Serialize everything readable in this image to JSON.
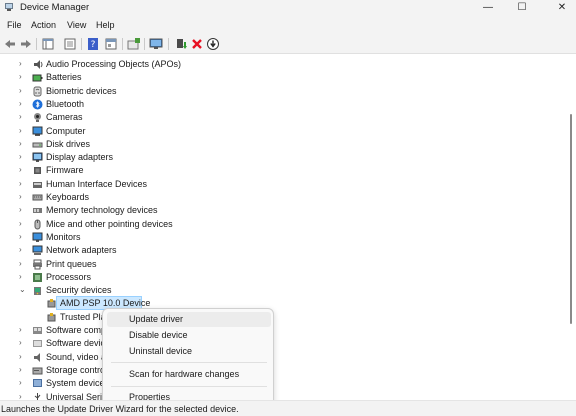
{
  "window": {
    "title": "Device Manager",
    "minimize": "—",
    "maximize": "☐",
    "close": "✕"
  },
  "menu": [
    "File",
    "Action",
    "View",
    "Help"
  ],
  "toolbar": [
    "back-icon",
    "forward-icon",
    "show-hide-tree-icon",
    "properties-icon",
    "help-icon",
    "view-resources-icon",
    "update-driver-icon",
    "scan-hardware-icon",
    "add-driver-icon",
    "uninstall-icon",
    "disable-icon"
  ],
  "tree": [
    {
      "label": "Audio Processing Objects (APOs)",
      "icon": "speaker-icon",
      "expanded": false
    },
    {
      "label": "Batteries",
      "icon": "battery-icon",
      "expanded": false
    },
    {
      "label": "Biometric devices",
      "icon": "fingerprint-icon",
      "expanded": false
    },
    {
      "label": "Bluetooth",
      "icon": "bluetooth-icon",
      "expanded": false
    },
    {
      "label": "Cameras",
      "icon": "camera-icon",
      "expanded": false
    },
    {
      "label": "Computer",
      "icon": "computer-icon",
      "expanded": false
    },
    {
      "label": "Disk drives",
      "icon": "disk-icon",
      "expanded": false
    },
    {
      "label": "Display adapters",
      "icon": "display-icon",
      "expanded": false
    },
    {
      "label": "Firmware",
      "icon": "chip-icon",
      "expanded": false
    },
    {
      "label": "Human Interface Devices",
      "icon": "hid-icon",
      "expanded": false
    },
    {
      "label": "Keyboards",
      "icon": "keyboard-icon",
      "expanded": false
    },
    {
      "label": "Memory technology devices",
      "icon": "memory-icon",
      "expanded": false
    },
    {
      "label": "Mice and other pointing devices",
      "icon": "mouse-icon",
      "expanded": false
    },
    {
      "label": "Monitors",
      "icon": "monitor-icon",
      "expanded": false
    },
    {
      "label": "Network adapters",
      "icon": "network-icon",
      "expanded": false
    },
    {
      "label": "Print queues",
      "icon": "printer-icon",
      "expanded": false
    },
    {
      "label": "Processors",
      "icon": "processor-icon",
      "expanded": false
    },
    {
      "label": "Security devices",
      "icon": "security-icon",
      "expanded": true
    },
    {
      "label": "AMD PSP 10.0 Device",
      "icon": "security-device-icon",
      "child": true,
      "selected": true
    },
    {
      "label": "Trusted Pla",
      "icon": "security-device-icon",
      "child": true
    },
    {
      "label": "Software comp",
      "icon": "software-component-icon",
      "expanded": false
    },
    {
      "label": "Software devic",
      "icon": "software-device-icon",
      "expanded": false
    },
    {
      "label": "Sound, video a",
      "icon": "sound-icon",
      "expanded": false
    },
    {
      "label": "Storage contro",
      "icon": "storage-icon",
      "expanded": false
    },
    {
      "label": "System device",
      "icon": "system-icon",
      "expanded": false
    },
    {
      "label": "Universal Seri",
      "icon": "usb-icon",
      "expanded": false
    }
  ],
  "context_menu": {
    "update": "Update driver",
    "disable": "Disable device",
    "uninstall": "Uninstall device",
    "scan": "Scan for hardware changes",
    "properties": "Properties"
  },
  "status": "Launches the Update Driver Wizard for the selected device.",
  "colors": {
    "selection": "#cce8ff",
    "accent": "#0067c0",
    "delete_red": "#e81123",
    "chrome": "#f3f3f3"
  }
}
